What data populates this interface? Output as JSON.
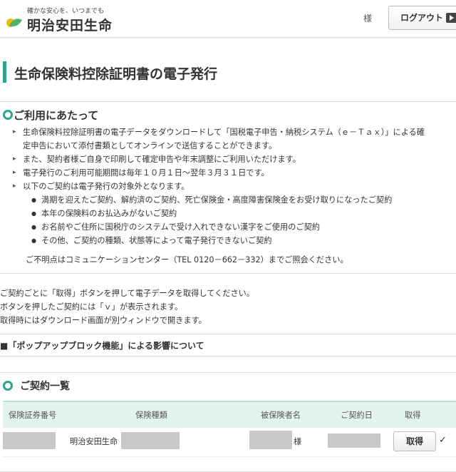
{
  "header": {
    "tagline": "確かな安心を、いつまでも",
    "company": "明治安田生命",
    "honorific": "様",
    "logout_label": "ログアウト"
  },
  "page": {
    "title": "生命保険料控除証明書の電子発行"
  },
  "usage": {
    "heading": "ご利用にあたって",
    "items": [
      "生命保険料控除証明書の電子データをダウンロードして「国税電子申告・納税システム（ｅ－Ｔａｘ）」による確",
      "定申告において添付書類としてオンラインで送信することができます。",
      "また、契約者様ご自身で印刷して確定申告や年末調整にご利用いただけます。",
      "電子発行のご利用可能期間は毎年１０月１日～翌年３月３１日です。",
      "以下のご契約は電子発行の対象外となります。"
    ],
    "exclusions": [
      "満期を迎えたご契約、解約済のご契約、死亡保険金・高度障害保険金をお受け取りになったご契約",
      "本年の保険料のお払込みがないご契約",
      "お名前やご住所に国税庁のシステムで受け入れできない漢字をご使用のご契約",
      "その他、ご契約の種類、状態等によって電子発行できないご契約"
    ],
    "contact": "ご不明点はコミュニケーションセンター（TEL 0120－662－332）までご照会ください。"
  },
  "notes": [
    "ご契約ごとに「取得」ボタンを押して電子データを取得してください。",
    "ボタンを押したご契約には「ｖ」が表示されます。",
    "取得時にはダウンロード画面が別ウィンドウで開きます。"
  ],
  "popup": {
    "heading": "■「ポップアップブロック機能」による影響について"
  },
  "contracts": {
    "heading": "ご契約一覧",
    "columns": [
      "保険証券番号",
      "保険種類",
      "被保険者名",
      "ご契約日",
      "取得"
    ],
    "rows": [
      {
        "insurance_type": "明治安田生命",
        "honorific": "様",
        "get_label": "取得",
        "status_mark": "✓"
      }
    ]
  },
  "colors": {
    "accent": "#2aa58c",
    "table_header_bg": "#e3f4f0",
    "logo_green": "#4cb26a",
    "logo_yellow": "#f2b705"
  }
}
